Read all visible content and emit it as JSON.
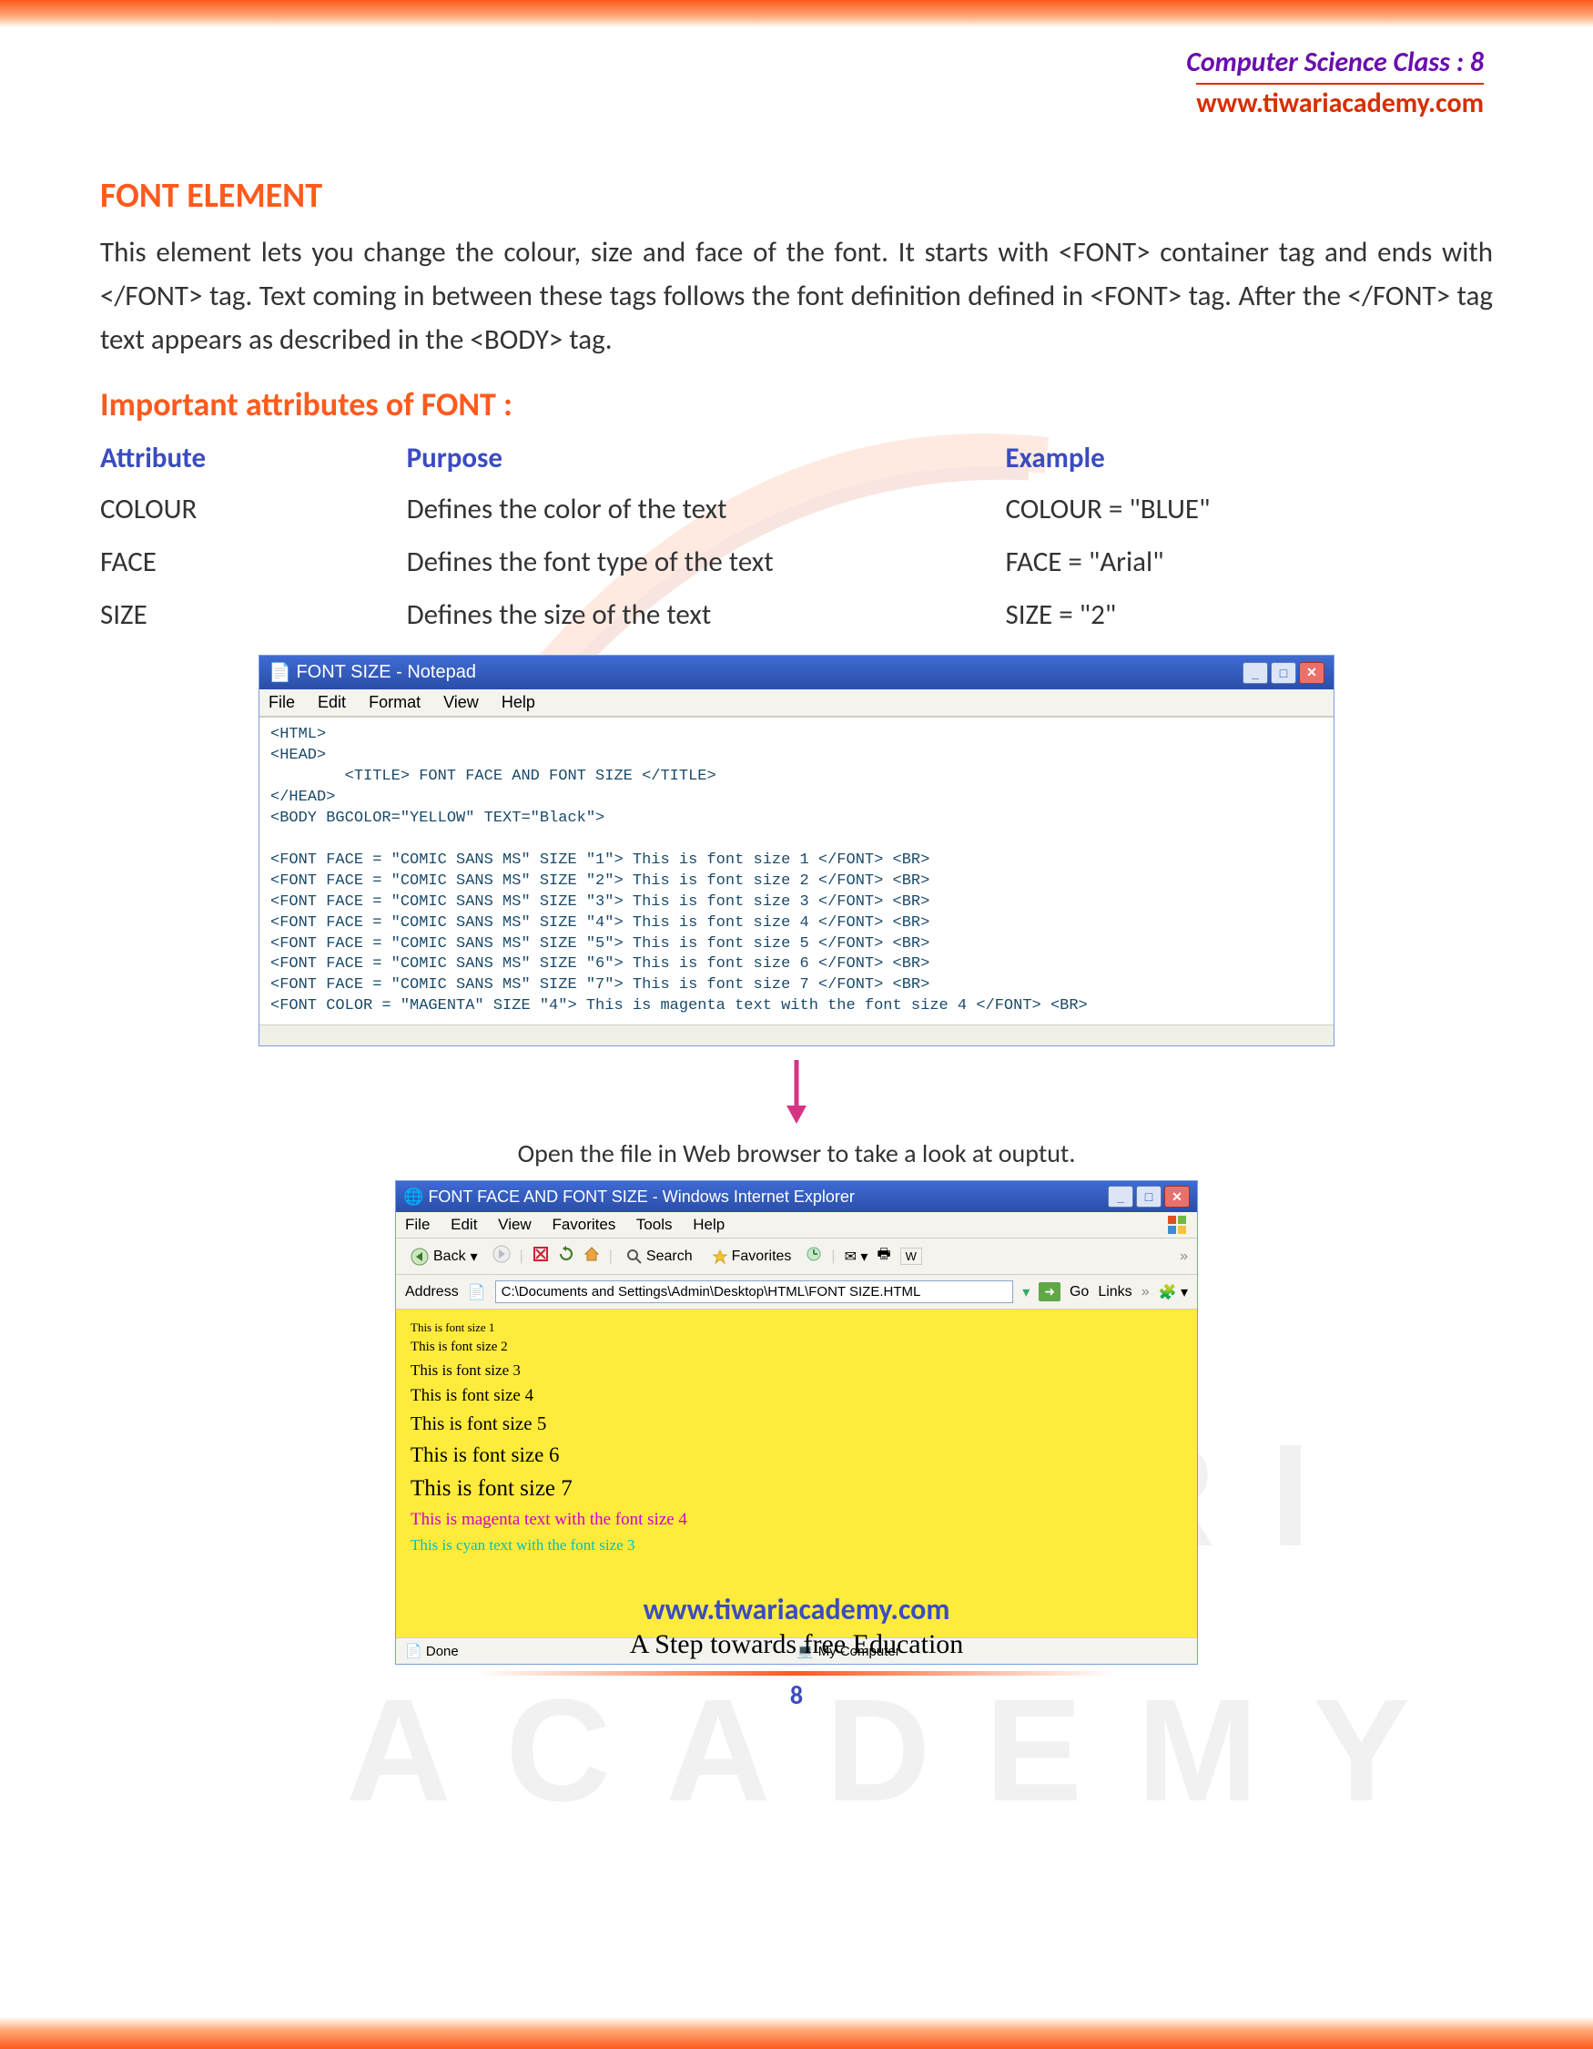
{
  "header": {
    "title": "Computer Science Class : 8",
    "url": "www.tiwariacademy.com"
  },
  "s1_title": "FONT ELEMENT",
  "s1_body": "This element lets you change the colour, size and face of the font. It starts with <FONT> container tag and ends with </FONT> tag. Text coming in between these tags follows the font definition defined in <FONT> tag. After the </FONT> tag text appears as described in the <BODY> tag.",
  "s2_title": "Important attributes of FONT :",
  "tbl": {
    "h1": "Attribute",
    "h2": "Purpose",
    "h3": "Example",
    "r1c1": "COLOUR",
    "r1c2": "Defines the color of the text",
    "r1c3": "COLOUR = \"BLUE\"",
    "r2c1": "FACE",
    "r2c2": "Defines the font type of the text",
    "r2c3": "FACE = \"Arial\"",
    "r3c1": "SIZE",
    "r3c2": "Defines the size of the text",
    "r3c3": "SIZE = \"2\""
  },
  "notepad": {
    "title": "FONT SIZE - Notepad",
    "menu": {
      "file": "File",
      "edit": "Edit",
      "format": "Format",
      "view": "View",
      "help": "Help"
    },
    "code": "<HTML>\n<HEAD>\n        <TITLE> FONT FACE AND FONT SIZE </TITLE>\n</HEAD>\n<BODY BGCOLOR=\"YELLOW\" TEXT=\"Black\">\n\n<FONT FACE = \"COMIC SANS MS\" SIZE \"1\"> This is font size 1 </FONT> <BR>\n<FONT FACE = \"COMIC SANS MS\" SIZE \"2\"> This is font size 2 </FONT> <BR>\n<FONT FACE = \"COMIC SANS MS\" SIZE \"3\"> This is font size 3 </FONT> <BR>\n<FONT FACE = \"COMIC SANS MS\" SIZE \"4\"> This is font size 4 </FONT> <BR>\n<FONT FACE = \"COMIC SANS MS\" SIZE \"5\"> This is font size 5 </FONT> <BR>\n<FONT FACE = \"COMIC SANS MS\" SIZE \"6\"> This is font size 6 </FONT> <BR>\n<FONT FACE = \"COMIC SANS MS\" SIZE \"7\"> This is font size 7 </FONT> <BR>\n<FONT COLOR = \"MAGENTA\" SIZE \"4\"> This is magenta text with the font size 4 </FONT> <BR>"
  },
  "caption": "Open the file in Web browser to take a look at ouptut.",
  "ie": {
    "title": "FONT FACE AND FONT SIZE - Windows Internet Explorer",
    "menu": {
      "file": "File",
      "edit": "Edit",
      "view": "View",
      "fav": "Favorites",
      "tools": "Tools",
      "help": "Help"
    },
    "tb": {
      "back": "Back",
      "search": "Search",
      "favorites": "Favorites"
    },
    "addr_label": "Address",
    "addr": "C:\\Documents and Settings\\Admin\\Desktop\\HTML\\FONT SIZE.HTML",
    "go": "Go",
    "links": "Links",
    "lines": {
      "l1": "This is font size 1",
      "l2": "This is font size 2",
      "l3": "This is font size 3",
      "l4": "This is font size 4",
      "l5": "This is font size 5",
      "l6": "This is font size 6",
      "l7": "This is font size 7",
      "mag": "This is magenta text with the font size 4",
      "cyan": "This is cyan text with the font size 3"
    },
    "status": {
      "done": "Done",
      "zone": "My Computer"
    }
  },
  "footer": {
    "url": "www.tiwariacademy.com",
    "tag": "A Step towards free Education",
    "page": "8"
  },
  "watermark": {
    "line1": "T I W A R I",
    "line2": "A C A D E M Y"
  }
}
